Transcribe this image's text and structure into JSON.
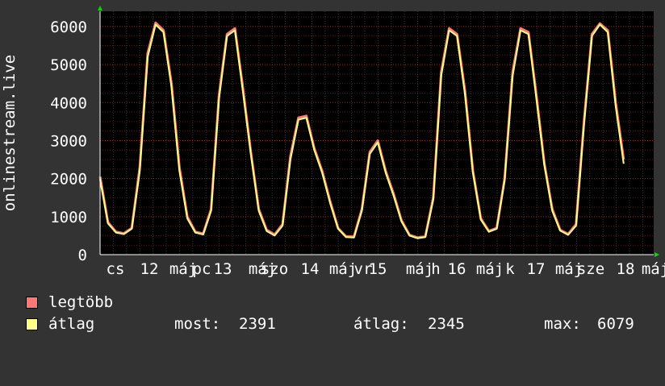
{
  "chart_data": {
    "type": "line",
    "ylabel": "onlinestream.live",
    "ylim": [
      0,
      6400
    ],
    "yticks": [
      0,
      1000,
      2000,
      3000,
      4000,
      5000,
      6000
    ],
    "grid": true,
    "x_tick_labels": [
      "cs",
      "12",
      "máj",
      "pc",
      "13",
      "máj",
      "szo",
      "14",
      "máj",
      "vr",
      "15",
      "máj",
      "h",
      "16",
      "máj",
      "k",
      "17",
      "máj",
      "sze",
      "18",
      "máj"
    ],
    "x_day_ticks": [
      "12",
      "13",
      "14",
      "15",
      "16",
      "17",
      "18"
    ],
    "colors": {
      "max": "#ff7777",
      "avg": "#ffff88",
      "grid": "#ff0000",
      "axis": "#ffffff",
      "arrow": "#00dd00"
    },
    "series": [
      {
        "name": "legtöbb",
        "color": "#ff7777",
        "x_days": [
          0,
          0.1,
          0.2,
          0.3,
          0.4,
          0.5,
          0.6,
          0.7,
          0.8,
          0.9,
          1,
          1.1,
          1.2,
          1.3,
          1.4,
          1.5,
          1.6,
          1.7,
          1.8,
          1.9,
          2,
          2.1,
          2.2,
          2.3,
          2.4,
          2.5,
          2.6,
          2.7,
          2.8,
          2.9,
          3,
          3.1,
          3.2,
          3.3,
          3.4,
          3.5,
          3.6,
          3.7,
          3.8,
          3.9,
          4,
          4.1,
          4.2,
          4.3,
          4.4,
          4.5,
          4.6,
          4.7,
          4.8,
          4.9,
          5,
          5.1,
          5.2,
          5.3,
          5.4,
          5.5,
          5.6,
          5.7,
          5.8,
          5.9,
          6,
          6.1,
          6.2,
          6.3,
          6.4,
          6.5,
          6.6,
          6.7,
          6.8,
          6.9,
          6.95
        ],
        "values": [
          2050,
          850,
          600,
          560,
          700,
          2300,
          5300,
          6100,
          5900,
          4500,
          2300,
          1000,
          600,
          550,
          1200,
          4200,
          5800,
          5950,
          4400,
          2700,
          1200,
          650,
          530,
          800,
          2600,
          3600,
          3650,
          2800,
          2200,
          1400,
          700,
          480,
          470,
          1200,
          2700,
          3000,
          2200,
          1600,
          900,
          520,
          450,
          480,
          1500,
          4800,
          5950,
          5800,
          4300,
          2200,
          950,
          620,
          700,
          2000,
          4800,
          5950,
          5850,
          4200,
          2400,
          1200,
          650,
          540,
          800,
          3500,
          5800,
          6080,
          5900,
          4000,
          2500
        ]
      },
      {
        "name": "átlag",
        "color": "#ffff88",
        "x_days": [
          0,
          0.1,
          0.2,
          0.3,
          0.4,
          0.5,
          0.6,
          0.7,
          0.8,
          0.9,
          1,
          1.1,
          1.2,
          1.3,
          1.4,
          1.5,
          1.6,
          1.7,
          1.8,
          1.9,
          2,
          2.1,
          2.2,
          2.3,
          2.4,
          2.5,
          2.6,
          2.7,
          2.8,
          2.9,
          3,
          3.1,
          3.2,
          3.3,
          3.4,
          3.5,
          3.6,
          3.7,
          3.8,
          3.9,
          4,
          4.1,
          4.2,
          4.3,
          4.4,
          4.5,
          4.6,
          4.7,
          4.8,
          4.9,
          5,
          5.1,
          5.2,
          5.3,
          5.4,
          5.5,
          5.6,
          5.7,
          5.8,
          5.9,
          6,
          6.1,
          6.2,
          6.3,
          6.4,
          6.5,
          6.6,
          6.7,
          6.8,
          6.9,
          6.95
        ],
        "values": [
          1980,
          820,
          580,
          540,
          680,
          2200,
          5200,
          6050,
          5850,
          4400,
          2200,
          950,
          580,
          530,
          1150,
          4100,
          5750,
          5900,
          4300,
          2650,
          1150,
          620,
          500,
          760,
          2500,
          3550,
          3600,
          2750,
          2150,
          1350,
          680,
          460,
          450,
          1150,
          2650,
          2950,
          2150,
          1550,
          870,
          500,
          430,
          460,
          1450,
          4700,
          5900,
          5750,
          4200,
          2150,
          920,
          600,
          680,
          1950,
          4700,
          5900,
          5800,
          4100,
          2350,
          1150,
          630,
          520,
          760,
          3400,
          5750,
          6050,
          5850,
          3900,
          2391
        ]
      }
    ],
    "legend": [
      {
        "label": "legtöbb",
        "color": "#ff7777"
      },
      {
        "label": "átlag",
        "color": "#ffff88"
      }
    ],
    "stats": {
      "now_label": "most:",
      "now": "2391",
      "avg_label": "átlag:",
      "avg": "2345",
      "max_label": "max:",
      "max": "6079"
    }
  }
}
